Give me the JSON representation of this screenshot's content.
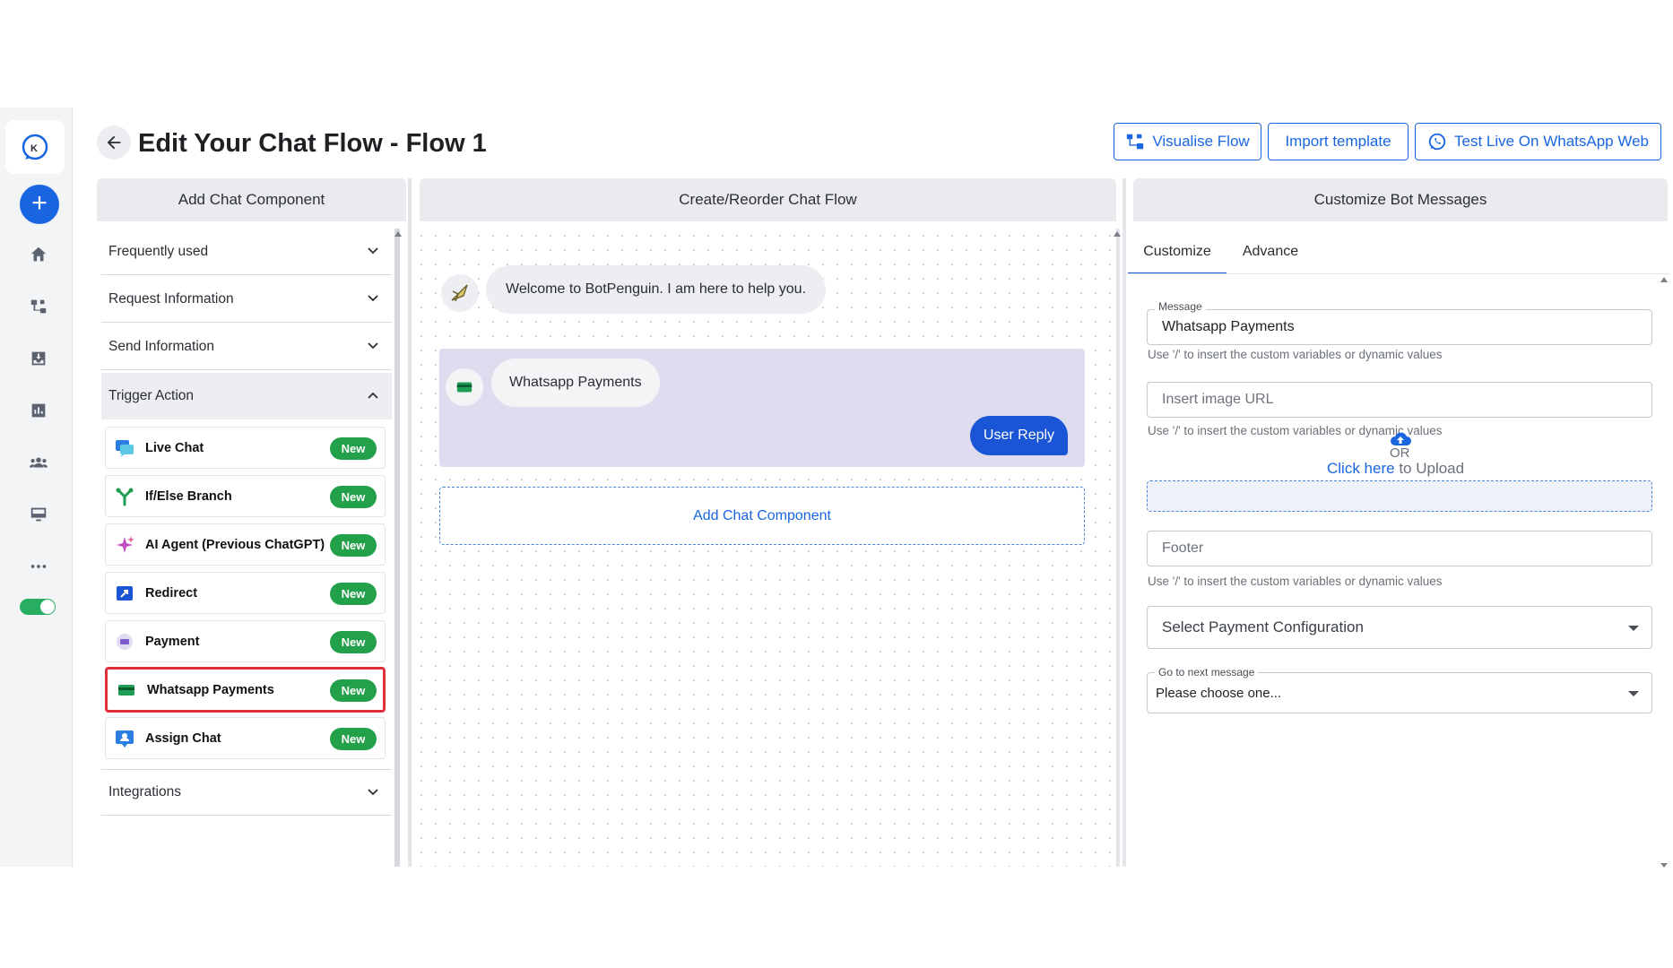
{
  "header": {
    "title": "Edit Your Chat Flow - Flow 1",
    "visualise_label": "Visualise Flow",
    "import_label": "Import template",
    "test_label": "Test Live On WhatsApp Web"
  },
  "columns": {
    "left": "Add Chat Component",
    "middle": "Create/Reorder Chat Flow",
    "right": "Customize Bot Messages"
  },
  "left_panel": {
    "sections": [
      {
        "label": "Frequently used",
        "expanded": false
      },
      {
        "label": "Request Information",
        "expanded": false
      },
      {
        "label": "Send Information",
        "expanded": false
      },
      {
        "label": "Trigger Action",
        "expanded": true
      },
      {
        "label": "Integrations",
        "expanded": false
      }
    ],
    "trigger_items": [
      {
        "label": "Live Chat",
        "badge": "New",
        "icon": "live-chat-icon"
      },
      {
        "label": "If/Else Branch",
        "badge": "New",
        "icon": "branch-icon"
      },
      {
        "label": "AI Agent (Previous ChatGPT)",
        "badge": "New",
        "icon": "sparkle-icon"
      },
      {
        "label": "Redirect",
        "badge": "New",
        "icon": "redirect-icon"
      },
      {
        "label": "Payment",
        "badge": "New",
        "icon": "payment-icon"
      },
      {
        "label": "Whatsapp Payments",
        "badge": "New",
        "icon": "card-icon",
        "selected": true
      },
      {
        "label": "Assign Chat",
        "badge": "New",
        "icon": "assign-chat-icon"
      }
    ]
  },
  "flow": {
    "welcome_message": "Welcome to BotPenguin. I am here to help you.",
    "card_message": "Whatsapp Payments",
    "user_reply": "User Reply",
    "add_component": "Add Chat Component"
  },
  "right_panel": {
    "tabs": [
      "Customize",
      "Advance"
    ],
    "active_tab": "Customize",
    "message_legend": "Message",
    "message_value": "Whatsapp Payments",
    "hint": "Use '/' to insert the custom variables or dynamic values",
    "image_url_placeholder": "Insert image URL",
    "or_text": "OR",
    "click_here": "Click here",
    "to_upload": " to Upload",
    "footer_placeholder": "Footer",
    "payment_config_placeholder": "Select Payment Configuration",
    "next_message_legend": "Go to next message",
    "next_message_value": "Please choose one..."
  },
  "colors": {
    "accent": "#1a66e0",
    "badge": "#23a14a",
    "selection": "#e0303c",
    "card_bg": "#dfdcf0"
  }
}
